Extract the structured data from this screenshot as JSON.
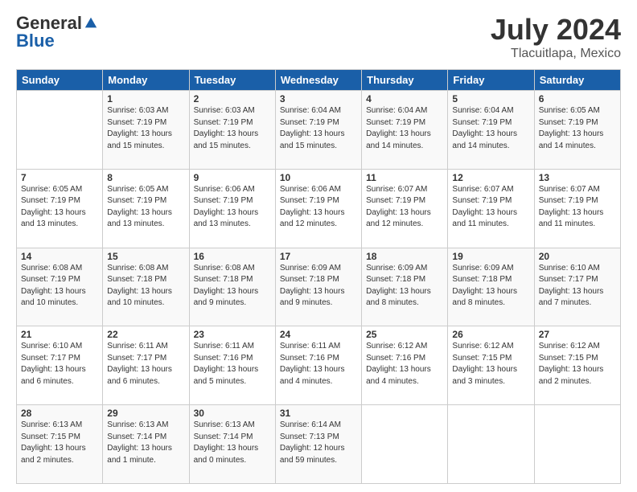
{
  "header": {
    "logo_general": "General",
    "logo_blue": "Blue",
    "title": "July 2024",
    "subtitle": "Tlacuitlapa, Mexico"
  },
  "columns": [
    "Sunday",
    "Monday",
    "Tuesday",
    "Wednesday",
    "Thursday",
    "Friday",
    "Saturday"
  ],
  "weeks": [
    [
      {
        "day": "",
        "info": ""
      },
      {
        "day": "1",
        "info": "Sunrise: 6:03 AM\nSunset: 7:19 PM\nDaylight: 13 hours\nand 15 minutes."
      },
      {
        "day": "2",
        "info": "Sunrise: 6:03 AM\nSunset: 7:19 PM\nDaylight: 13 hours\nand 15 minutes."
      },
      {
        "day": "3",
        "info": "Sunrise: 6:04 AM\nSunset: 7:19 PM\nDaylight: 13 hours\nand 15 minutes."
      },
      {
        "day": "4",
        "info": "Sunrise: 6:04 AM\nSunset: 7:19 PM\nDaylight: 13 hours\nand 14 minutes."
      },
      {
        "day": "5",
        "info": "Sunrise: 6:04 AM\nSunset: 7:19 PM\nDaylight: 13 hours\nand 14 minutes."
      },
      {
        "day": "6",
        "info": "Sunrise: 6:05 AM\nSunset: 7:19 PM\nDaylight: 13 hours\nand 14 minutes."
      }
    ],
    [
      {
        "day": "7",
        "info": "Sunrise: 6:05 AM\nSunset: 7:19 PM\nDaylight: 13 hours\nand 13 minutes."
      },
      {
        "day": "8",
        "info": "Sunrise: 6:05 AM\nSunset: 7:19 PM\nDaylight: 13 hours\nand 13 minutes."
      },
      {
        "day": "9",
        "info": "Sunrise: 6:06 AM\nSunset: 7:19 PM\nDaylight: 13 hours\nand 13 minutes."
      },
      {
        "day": "10",
        "info": "Sunrise: 6:06 AM\nSunset: 7:19 PM\nDaylight: 13 hours\nand 12 minutes."
      },
      {
        "day": "11",
        "info": "Sunrise: 6:07 AM\nSunset: 7:19 PM\nDaylight: 13 hours\nand 12 minutes."
      },
      {
        "day": "12",
        "info": "Sunrise: 6:07 AM\nSunset: 7:19 PM\nDaylight: 13 hours\nand 11 minutes."
      },
      {
        "day": "13",
        "info": "Sunrise: 6:07 AM\nSunset: 7:19 PM\nDaylight: 13 hours\nand 11 minutes."
      }
    ],
    [
      {
        "day": "14",
        "info": "Sunrise: 6:08 AM\nSunset: 7:19 PM\nDaylight: 13 hours\nand 10 minutes."
      },
      {
        "day": "15",
        "info": "Sunrise: 6:08 AM\nSunset: 7:18 PM\nDaylight: 13 hours\nand 10 minutes."
      },
      {
        "day": "16",
        "info": "Sunrise: 6:08 AM\nSunset: 7:18 PM\nDaylight: 13 hours\nand 9 minutes."
      },
      {
        "day": "17",
        "info": "Sunrise: 6:09 AM\nSunset: 7:18 PM\nDaylight: 13 hours\nand 9 minutes."
      },
      {
        "day": "18",
        "info": "Sunrise: 6:09 AM\nSunset: 7:18 PM\nDaylight: 13 hours\nand 8 minutes."
      },
      {
        "day": "19",
        "info": "Sunrise: 6:09 AM\nSunset: 7:18 PM\nDaylight: 13 hours\nand 8 minutes."
      },
      {
        "day": "20",
        "info": "Sunrise: 6:10 AM\nSunset: 7:17 PM\nDaylight: 13 hours\nand 7 minutes."
      }
    ],
    [
      {
        "day": "21",
        "info": "Sunrise: 6:10 AM\nSunset: 7:17 PM\nDaylight: 13 hours\nand 6 minutes."
      },
      {
        "day": "22",
        "info": "Sunrise: 6:11 AM\nSunset: 7:17 PM\nDaylight: 13 hours\nand 6 minutes."
      },
      {
        "day": "23",
        "info": "Sunrise: 6:11 AM\nSunset: 7:16 PM\nDaylight: 13 hours\nand 5 minutes."
      },
      {
        "day": "24",
        "info": "Sunrise: 6:11 AM\nSunset: 7:16 PM\nDaylight: 13 hours\nand 4 minutes."
      },
      {
        "day": "25",
        "info": "Sunrise: 6:12 AM\nSunset: 7:16 PM\nDaylight: 13 hours\nand 4 minutes."
      },
      {
        "day": "26",
        "info": "Sunrise: 6:12 AM\nSunset: 7:15 PM\nDaylight: 13 hours\nand 3 minutes."
      },
      {
        "day": "27",
        "info": "Sunrise: 6:12 AM\nSunset: 7:15 PM\nDaylight: 13 hours\nand 2 minutes."
      }
    ],
    [
      {
        "day": "28",
        "info": "Sunrise: 6:13 AM\nSunset: 7:15 PM\nDaylight: 13 hours\nand 2 minutes."
      },
      {
        "day": "29",
        "info": "Sunrise: 6:13 AM\nSunset: 7:14 PM\nDaylight: 13 hours\nand 1 minute."
      },
      {
        "day": "30",
        "info": "Sunrise: 6:13 AM\nSunset: 7:14 PM\nDaylight: 13 hours\nand 0 minutes."
      },
      {
        "day": "31",
        "info": "Sunrise: 6:14 AM\nSunset: 7:13 PM\nDaylight: 12 hours\nand 59 minutes."
      },
      {
        "day": "",
        "info": ""
      },
      {
        "day": "",
        "info": ""
      },
      {
        "day": "",
        "info": ""
      }
    ]
  ]
}
